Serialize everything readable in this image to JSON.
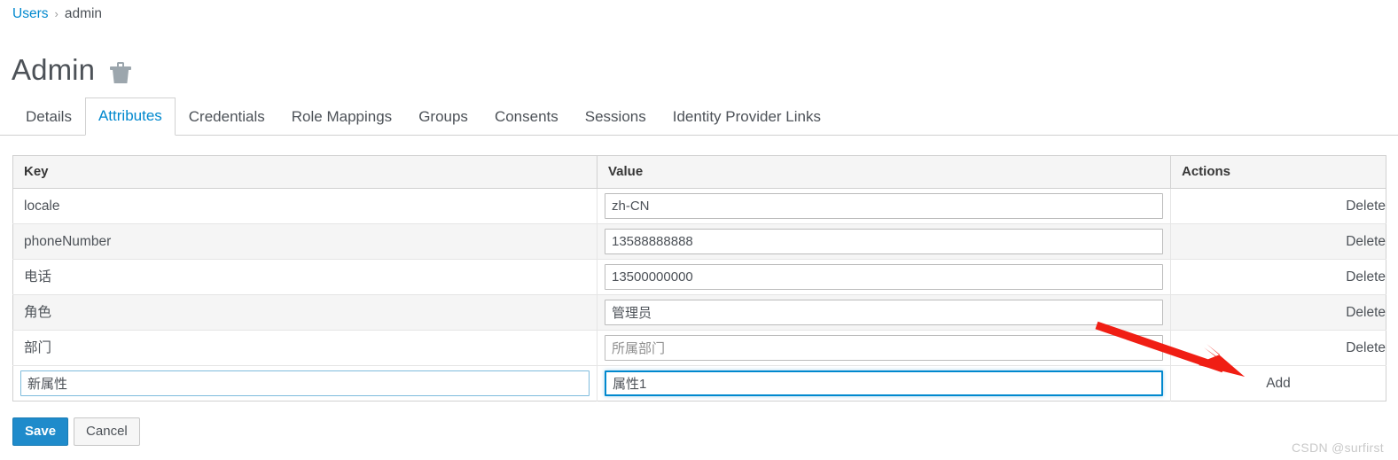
{
  "breadcrumb": {
    "link_label": "Users",
    "separator": "›",
    "current_label": "admin"
  },
  "header": {
    "title": "Admin",
    "delete_icon": "trash-icon"
  },
  "tabs": [
    {
      "label": "Details",
      "active": false
    },
    {
      "label": "Attributes",
      "active": true
    },
    {
      "label": "Credentials",
      "active": false
    },
    {
      "label": "Role Mappings",
      "active": false
    },
    {
      "label": "Groups",
      "active": false
    },
    {
      "label": "Consents",
      "active": false
    },
    {
      "label": "Sessions",
      "active": false
    },
    {
      "label": "Identity Provider Links",
      "active": false
    }
  ],
  "table": {
    "columns": [
      "Key",
      "Value",
      "Actions"
    ],
    "rows": [
      {
        "key": "locale",
        "value": "zh-CN",
        "action": "Delete"
      },
      {
        "key": "phoneNumber",
        "value": "13588888888",
        "action": "Delete"
      },
      {
        "key": "电话",
        "value": "13500000000",
        "action": "Delete"
      },
      {
        "key": "角色",
        "value": "管理员",
        "action": "Delete"
      },
      {
        "key": "部门",
        "value": "所属部门",
        "action": "Delete"
      }
    ],
    "new_row": {
      "key_value": "新属性",
      "value_value": "属性1",
      "action": "Add"
    }
  },
  "form_actions": {
    "save_label": "Save",
    "cancel_label": "Cancel"
  },
  "watermark": "CSDN @surfirst",
  "colors": {
    "link_blue": "#0088ce",
    "active_tab_blue": "#0088ce",
    "primary_button": "#1f8bcb",
    "focus_border": "#0088ce",
    "annotation_arrow": "#f01e14",
    "text": "#4d5258",
    "table_border": "#d1d1d1",
    "stripe": "#f5f5f5"
  }
}
